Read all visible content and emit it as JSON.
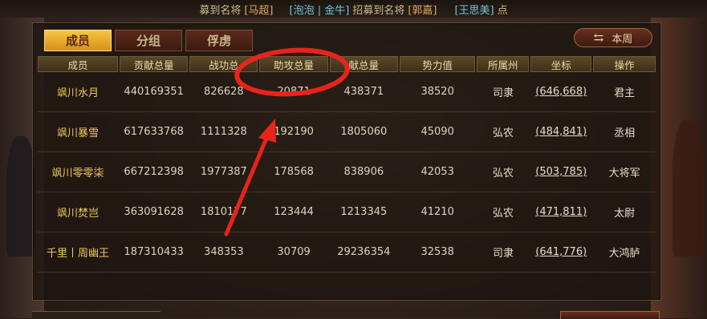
{
  "ticker": {
    "seg1": "募到名将",
    "seg2": "[马超]",
    "seg3": "[泡泡 | 金牛]",
    "seg4": "招募到名将",
    "seg5": "[郭嘉]",
    "seg6": "[王思美]",
    "seg7": "点"
  },
  "tabs": [
    "成员",
    "分组",
    "俘虏"
  ],
  "week_button": {
    "label": "本周",
    "icon": "refresh-icon"
  },
  "columns": [
    "成员",
    "贡献总量",
    "战功总",
    "助攻总量",
    "献总量",
    "势力值",
    "所属州",
    "坐标",
    "操作"
  ],
  "rows": [
    {
      "name": "飒川水月",
      "contrib": "440169351",
      "merit": "826628",
      "assist": "20871",
      "donate": "438371",
      "power": "38520",
      "state": "司隶",
      "coord": "(646,668)",
      "role": "君主"
    },
    {
      "name": "飒川暴雪",
      "contrib": "617633768",
      "merit": "1111328",
      "assist": "192190",
      "donate": "1805060",
      "power": "45090",
      "state": "弘农",
      "coord": "(484,841)",
      "role": "丞相"
    },
    {
      "name": "飒川零零柒",
      "contrib": "667212398",
      "merit": "1977387",
      "assist": "178568",
      "donate": "838906",
      "power": "42053",
      "state": "弘农",
      "coord": "(503,785)",
      "role": "大将军"
    },
    {
      "name": "飒川焚岂",
      "contrib": "363091628",
      "merit": "1810177",
      "assist": "123444",
      "donate": "1213345",
      "power": "41210",
      "state": "弘农",
      "coord": "(471,811)",
      "role": "太尉"
    },
    {
      "name": "千里丨周幽王",
      "contrib": "187310433",
      "merit": "348353",
      "assist": "30709",
      "donate": "29236354",
      "power": "32538",
      "state": "司隶",
      "coord": "(641,776)",
      "role": "大鸿胪"
    },
    {
      "name": "",
      "contrib": "",
      "merit": "",
      "assist": "",
      "donate": "",
      "power": "",
      "state": "",
      "coord": "",
      "role": ""
    }
  ],
  "colors": {
    "tab_active": "#f0b830",
    "name_gold": "#f0c85a",
    "annotation_red": "#e8241a"
  }
}
